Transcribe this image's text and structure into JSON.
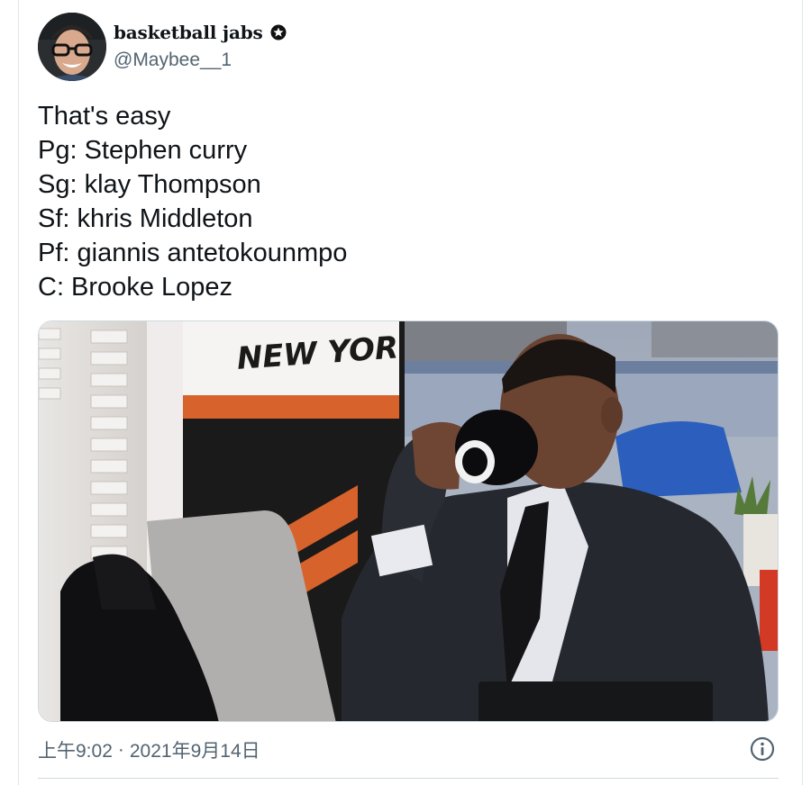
{
  "tweet": {
    "author": {
      "display_name": "basketball jabs",
      "handle": "@Maybee__1",
      "badge_icon": "verified-badge-icon"
    },
    "text_lines": [
      "That's easy",
      "Pg: Stephen curry",
      "Sg: klay Thompson",
      "Sf: khris Middleton",
      "Pf: giannis antetokounmpo",
      "C: Brooke Lopez"
    ],
    "media": {
      "sign_text": "NEW YORK"
    },
    "time": "上午9:02",
    "separator": "·",
    "date": "2021年9月14日",
    "info_icon": "info-icon"
  },
  "colors": {
    "text_primary": "#0f1419",
    "text_secondary": "#536471",
    "border": "#cfd9de",
    "accent_orange": "#d8622b"
  }
}
